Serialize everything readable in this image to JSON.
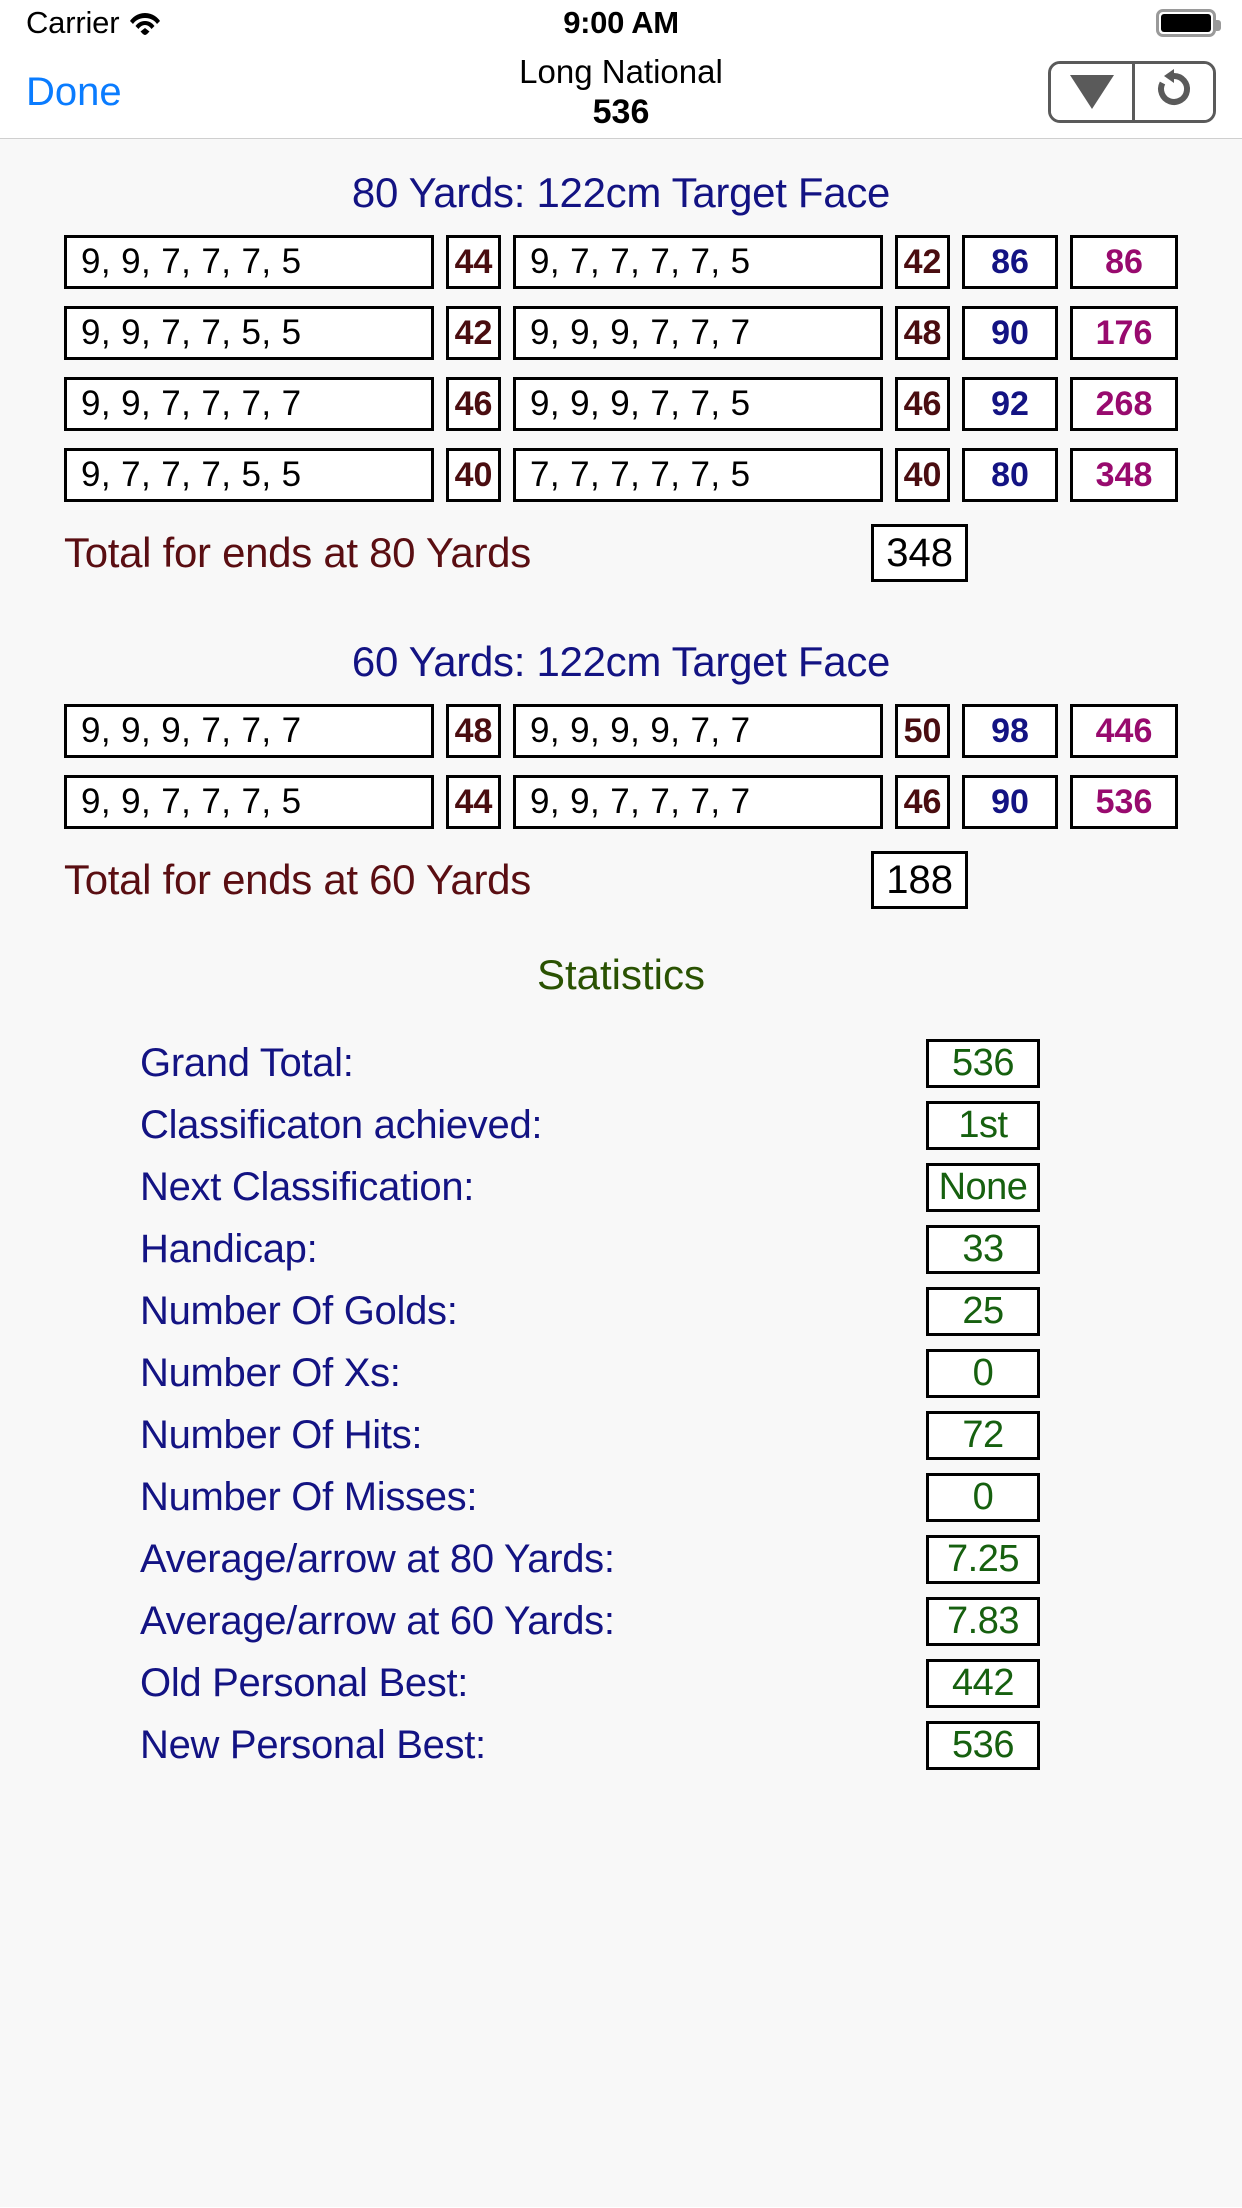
{
  "status_bar": {
    "carrier": "Carrier",
    "wifi_icon": "wifi-icon",
    "time": "9:00 AM",
    "battery_icon": "battery-full-icon"
  },
  "nav_bar": {
    "done_label": "Done",
    "title": "Long National",
    "subtitle": "536",
    "dropdown_icon": "triangle-down-icon",
    "refresh_icon": "refresh-counterclockwise-icon"
  },
  "colors": {
    "accent_blue": "#0a7cff",
    "heading_navy": "#131383",
    "end_total_maroon": "#4a0d10",
    "row_total_navy": "#131383",
    "running_total_purple": "#980a6e",
    "total_label_maroon": "#5a0e12",
    "stats_title_green": "#2a5202",
    "stats_value_green": "#16600f"
  },
  "distances": [
    {
      "heading": "80 Yards: 122cm Target Face",
      "rows": [
        {
          "end1_arrows": "9, 9, 7, 7, 7, 5",
          "end1_total": "44",
          "end2_arrows": "9, 7, 7, 7, 7, 5",
          "end2_total": "42",
          "row_total": "86",
          "running_total": "86"
        },
        {
          "end1_arrows": "9, 9, 7, 7, 5, 5",
          "end1_total": "42",
          "end2_arrows": "9, 9, 9, 7, 7, 7",
          "end2_total": "48",
          "row_total": "90",
          "running_total": "176"
        },
        {
          "end1_arrows": "9, 9, 7, 7, 7, 7",
          "end1_total": "46",
          "end2_arrows": "9, 9, 9, 7, 7, 5",
          "end2_total": "46",
          "row_total": "92",
          "running_total": "268"
        },
        {
          "end1_arrows": "9, 7, 7, 7, 5, 5",
          "end1_total": "40",
          "end2_arrows": "7, 7, 7, 7, 7, 5",
          "end2_total": "40",
          "row_total": "80",
          "running_total": "348"
        }
      ],
      "total_label": "Total for ends at 80 Yards",
      "total_value": "348"
    },
    {
      "heading": "60 Yards: 122cm Target Face",
      "rows": [
        {
          "end1_arrows": "9, 9, 9, 7, 7, 7",
          "end1_total": "48",
          "end2_arrows": "9, 9, 9, 9, 7, 7",
          "end2_total": "50",
          "row_total": "98",
          "running_total": "446"
        },
        {
          "end1_arrows": "9, 9, 7, 7, 7, 5",
          "end1_total": "44",
          "end2_arrows": "9, 9, 7, 7, 7, 7",
          "end2_total": "46",
          "row_total": "90",
          "running_total": "536"
        }
      ],
      "total_label": "Total for ends at 60 Yards",
      "total_value": "188"
    }
  ],
  "statistics": {
    "title": "Statistics",
    "items": [
      {
        "label": "Grand Total:",
        "value": "536"
      },
      {
        "label": "Classificaton achieved:",
        "value": "1st"
      },
      {
        "label": "Next Classification:",
        "value": "None"
      },
      {
        "label": "Handicap:",
        "value": "33"
      },
      {
        "label": "Number Of Golds:",
        "value": "25"
      },
      {
        "label": "Number Of Xs:",
        "value": "0"
      },
      {
        "label": "Number Of Hits:",
        "value": "72"
      },
      {
        "label": "Number Of Misses:",
        "value": "0"
      },
      {
        "label": "Average/arrow at 80 Yards:",
        "value": "7.25"
      },
      {
        "label": "Average/arrow at 60 Yards:",
        "value": "7.83"
      },
      {
        "label": "Old Personal Best:",
        "value": "442"
      },
      {
        "label": "New Personal Best:",
        "value": "536"
      }
    ]
  }
}
